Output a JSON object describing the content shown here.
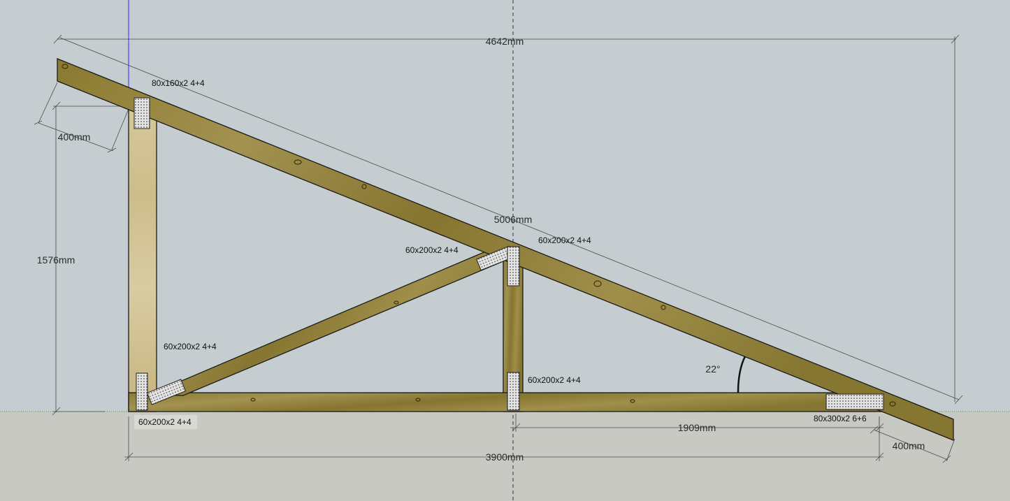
{
  "dimensions": {
    "top_length": "4642mm",
    "rafter_length": "5006mm",
    "overhang_left": "400mm",
    "post_height": "1576mm",
    "right_span": "1909mm",
    "overhang_right": "400mm",
    "base_length": "3900mm",
    "angle": "22°"
  },
  "connectors": [
    {
      "label": "80x160x2 4+4"
    },
    {
      "label": "60x200x2 4+4"
    },
    {
      "label": "60x200x2 4+4"
    },
    {
      "label": "60x200x2 4+4"
    },
    {
      "label": "60x200x2 4+4"
    },
    {
      "label": "60x200x2 4+4"
    },
    {
      "label": "80x300x2 6+6"
    }
  ],
  "colors": {
    "background_sky": "#c5cdd0",
    "background_ground": "#c9c9c4",
    "timber": "#8d7d33",
    "timber_light": "#a79752",
    "plate": "#d8d8d8",
    "axis_blue": "#2a2aff",
    "axis_green": "#3a9a3a"
  }
}
